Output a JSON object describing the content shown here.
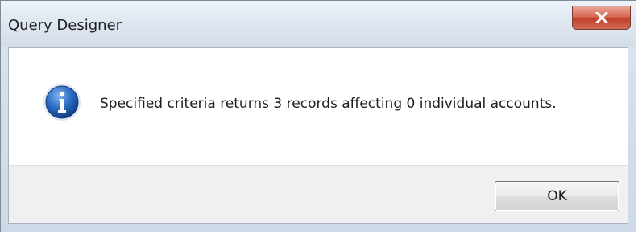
{
  "window": {
    "title": "Query Designer",
    "close_icon": "close-icon"
  },
  "dialog": {
    "icon": "info-icon",
    "message": "Specified criteria returns 3 records affecting 0 individual accounts.",
    "ok_label": "OK"
  },
  "colors": {
    "close_button": "#c94a34",
    "info_icon": "#1f5fb8",
    "footer": "#f0f0f0"
  }
}
